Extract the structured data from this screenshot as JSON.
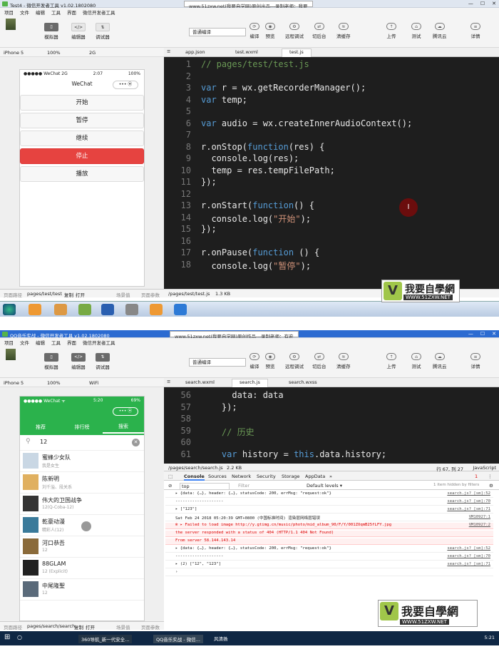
{
  "s1": {
    "title": "Test4 - 微信开发者工具 v1.02.1802080",
    "watermark": "www.51zxw.net(我要自学网)原创出品---录制老师：我要",
    "menu": [
      "项目",
      "文件",
      "编辑",
      "工具",
      "界面",
      "微信开发者工具"
    ],
    "toolbar": {
      "sim": "模拟器",
      "editor": "编辑器",
      "debug": "调试器",
      "mode": "普通编译",
      "compile": "编译",
      "preview": "预览",
      "remote": "远程调试",
      "switch": "切后台",
      "cache": "清缓存",
      "upload": "上传",
      "test": "测试",
      "tencent": "腾讯云",
      "detail": "详情"
    },
    "device": {
      "model": "iPhone 5",
      "zoom": "100%",
      "net": "2G"
    },
    "phone": {
      "carrier": "●●●●● WeChat 2G",
      "time": "2:07",
      "battery": "100%",
      "title": "WeChat",
      "capsule": "•••  ⦿"
    },
    "buttons": [
      "开始",
      "暂停",
      "继续",
      "停止",
      "播放"
    ],
    "tabs": [
      "app.json",
      "test.wxml",
      "test.js"
    ],
    "lines": [
      "1",
      "2",
      "3",
      "4",
      "5",
      "6",
      "7",
      "8",
      "9",
      "10",
      "11",
      "12",
      "13",
      "14",
      "15",
      "16",
      "17",
      "18"
    ],
    "code": [
      "// pages/test/test.js",
      "",
      "var r = wx.getRecorderManager();",
      "var temp;",
      "",
      "var audio = wx.createInnerAudioContext();",
      "",
      "r.onStop(function(res) {",
      "  console.log(res);",
      "  temp = res.tempFilePath;",
      "});",
      "",
      "r.onStart(function() {",
      "  console.log(\"开始\");",
      "});",
      "",
      "r.onPause(function () {",
      "  console.log(\"暂停\");",
      "});"
    ],
    "status": {
      "path_label": "页面路径",
      "path": "pages/test/test",
      "copy": "复制",
      "open": "打开",
      "scene": "场景值",
      "params": "页面参数",
      "file": "/pages/test/test.js",
      "size": "1.3 KB"
    },
    "cursor": "I"
  },
  "s2": {
    "title": "QQ音乐实战 - 微信开发者工具 v1.02.1802080",
    "watermark": "www.51zxw.net(我要自学网)原创作品---录制老师：有宏",
    "menu": [
      "项目",
      "文件",
      "编辑",
      "工具",
      "界面",
      "微信开发者工具"
    ],
    "device": {
      "model": "iPhone 5",
      "zoom": "100%",
      "net": "WiFi"
    },
    "phone": {
      "carrier": "●●●●● WeChat ᯤ",
      "time": "5:20",
      "battery": "69%",
      "tabs": [
        "推荐",
        "排行榜",
        "搜索"
      ],
      "query": "12"
    },
    "songs": [
      {
        "name": "蜜蜂少女队",
        "artist": "我是女生"
      },
      {
        "name": "陈新明",
        "artist": "刘千溢、段关系"
      },
      {
        "name": "伟大的卫国战争",
        "artist": "12(Q-Coba-12)"
      },
      {
        "name": "乾豪动漫",
        "artist": "精彩人(12)"
      },
      {
        "name": "河口恭吾",
        "artist": "12"
      },
      {
        "name": "88GLAM",
        "artist": "12 (Explicit)"
      },
      {
        "name": "中尾隆聖",
        "artist": "12"
      }
    ],
    "tabs": [
      "search.wxml",
      "search.js",
      "search.wxss"
    ],
    "lines": [
      "56",
      "57",
      "58",
      "59",
      "60",
      "61"
    ],
    "code": [
      "      data: data",
      "    });",
      "",
      "    // 历史",
      "",
      "    var history = this.data.history;"
    ],
    "file": {
      "path": "/pages/search/search.js",
      "size": "2.2 KB",
      "pos": "行 67, 列 27",
      "lang": "JavaScript"
    },
    "devtabs": [
      "Console",
      "Sources",
      "Network",
      "Security",
      "Storage",
      "AppData",
      "»"
    ],
    "filter": {
      "context": "top",
      "placeholder": "Filter",
      "level": "Default levels ▾",
      "hidden": "1 item hidden by filters"
    },
    "console": [
      {
        "text": "▸ {data: {…}, header: {…}, statusCode: 200, errMsg: \"request:ok\"}",
        "src": "search.js? [sm]:52",
        "err": false
      },
      {
        "text": "--------------------",
        "src": "search.js? [sm]:70",
        "err": false
      },
      {
        "text": "▸ [\"123\"]",
        "src": "search.js? [sm]:71",
        "err": false
      },
      {
        "text": "Sat Feb 24 2018 05:20:39 GMT+0800 (中国标准时间) 渲染层网络层错误",
        "src": "VM10927:1",
        "err": false
      },
      {
        "text": "⊗ ▸ Failed to load image http://y.gtimg.cn/music/photo/mid_album_90/F/Y/001ZOqmB25fLFY.jpg",
        "src": "VM10927:2",
        "err": true
      },
      {
        "text": "    the server responded with a status of 404 (HTTP/1.1 404 Not Found)",
        "src": "",
        "err": true
      },
      {
        "text": "    From server 58.144.143.14",
        "src": "",
        "err": true
      },
      {
        "text": "▸ {data: {…}, header: {…}, statusCode: 200, errMsg: \"request:ok\"}",
        "src": "search.js? [sm]:52",
        "err": false
      },
      {
        "text": "--------------------",
        "src": "search.js? [sm]:70",
        "err": false
      },
      {
        "text": "▸ (2) [\"12\", \"123\"]",
        "src": "search.js? [sm]:71",
        "err": false
      },
      {
        "text": "›",
        "src": "",
        "err": false
      }
    ],
    "status": {
      "path_label": "页面路径",
      "path": "pages/search/search",
      "copy": "复制",
      "open": "打开",
      "scene": "场景值",
      "params": "页面参数"
    },
    "taskbar": [
      "360导航_新一代安全...",
      "QQ音乐实战 - 微信...",
      "风清扬"
    ],
    "clock": "5:21",
    "error_badge": "1"
  },
  "logo": {
    "v": "V",
    "text": "我要自學網",
    "url": "WWW.51ZXW.NET"
  }
}
